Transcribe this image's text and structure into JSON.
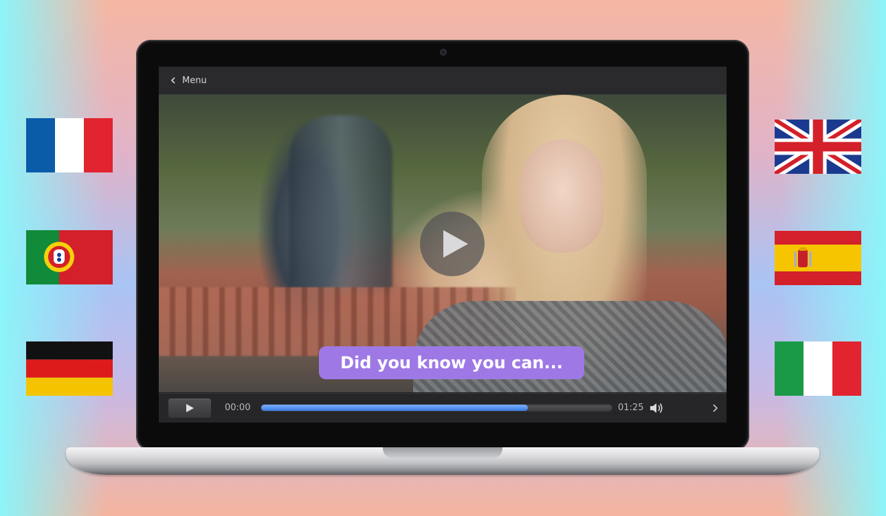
{
  "player": {
    "menu_label": "Menu",
    "caption_text": "Did you know you can...",
    "current_time": "00:00",
    "total_time": "01:25",
    "progress_fraction": 0.76
  },
  "flags_left": [
    "France",
    "Portugal",
    "Germany"
  ],
  "flags_right": [
    "United Kingdom",
    "Spain",
    "Italy"
  ],
  "colors": {
    "caption_bg": "#9e79e6",
    "progress_fill": "#3c7ae0",
    "laptop_bezel": "#0b0b0c"
  }
}
